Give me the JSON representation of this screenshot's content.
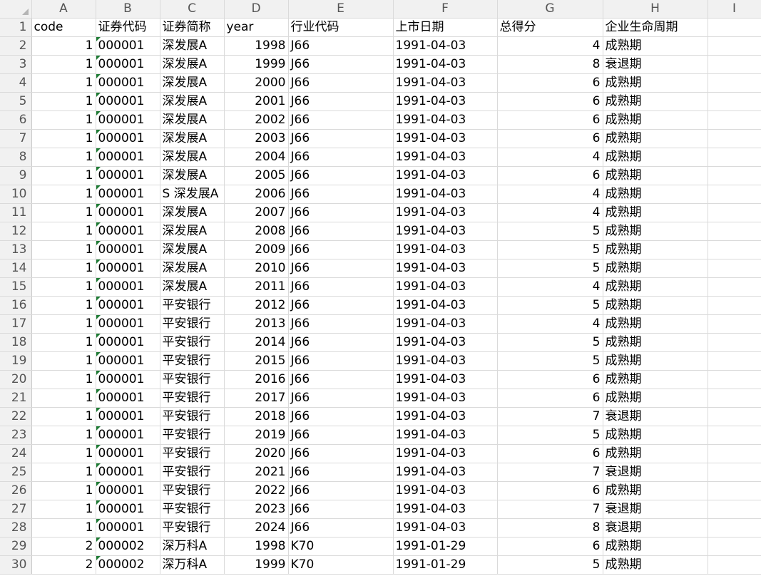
{
  "sheet": {
    "columns": [
      "A",
      "B",
      "C",
      "D",
      "E",
      "F",
      "G",
      "H",
      "I"
    ],
    "header_row": {
      "num": "1",
      "cells": [
        "code",
        "证券代码",
        "证券简称",
        "year",
        "行业代码",
        "上市日期",
        "总得分",
        "企业生命周期",
        ""
      ]
    },
    "rows": [
      {
        "num": "2",
        "cells": [
          "1",
          "000001",
          "深发展A",
          "1998",
          "J66",
          "1991-04-03",
          "4",
          "成熟期",
          ""
        ]
      },
      {
        "num": "3",
        "cells": [
          "1",
          "000001",
          "深发展A",
          "1999",
          "J66",
          "1991-04-03",
          "8",
          "衰退期",
          ""
        ]
      },
      {
        "num": "4",
        "cells": [
          "1",
          "000001",
          "深发展A",
          "2000",
          "J66",
          "1991-04-03",
          "6",
          "成熟期",
          ""
        ]
      },
      {
        "num": "5",
        "cells": [
          "1",
          "000001",
          "深发展A",
          "2001",
          "J66",
          "1991-04-03",
          "6",
          "成熟期",
          ""
        ]
      },
      {
        "num": "6",
        "cells": [
          "1",
          "000001",
          "深发展A",
          "2002",
          "J66",
          "1991-04-03",
          "6",
          "成熟期",
          ""
        ]
      },
      {
        "num": "7",
        "cells": [
          "1",
          "000001",
          "深发展A",
          "2003",
          "J66",
          "1991-04-03",
          "6",
          "成熟期",
          ""
        ]
      },
      {
        "num": "8",
        "cells": [
          "1",
          "000001",
          "深发展A",
          "2004",
          "J66",
          "1991-04-03",
          "4",
          "成熟期",
          ""
        ]
      },
      {
        "num": "9",
        "cells": [
          "1",
          "000001",
          "深发展A",
          "2005",
          "J66",
          "1991-04-03",
          "6",
          "成熟期",
          ""
        ]
      },
      {
        "num": "10",
        "cells": [
          "1",
          "000001",
          "S 深发展A",
          "2006",
          "J66",
          "1991-04-03",
          "4",
          "成熟期",
          ""
        ]
      },
      {
        "num": "11",
        "cells": [
          "1",
          "000001",
          "深发展A",
          "2007",
          "J66",
          "1991-04-03",
          "4",
          "成熟期",
          ""
        ]
      },
      {
        "num": "12",
        "cells": [
          "1",
          "000001",
          "深发展A",
          "2008",
          "J66",
          "1991-04-03",
          "5",
          "成熟期",
          ""
        ]
      },
      {
        "num": "13",
        "cells": [
          "1",
          "000001",
          "深发展A",
          "2009",
          "J66",
          "1991-04-03",
          "5",
          "成熟期",
          ""
        ]
      },
      {
        "num": "14",
        "cells": [
          "1",
          "000001",
          "深发展A",
          "2010",
          "J66",
          "1991-04-03",
          "5",
          "成熟期",
          ""
        ]
      },
      {
        "num": "15",
        "cells": [
          "1",
          "000001",
          "深发展A",
          "2011",
          "J66",
          "1991-04-03",
          "4",
          "成熟期",
          ""
        ]
      },
      {
        "num": "16",
        "cells": [
          "1",
          "000001",
          "平安银行",
          "2012",
          "J66",
          "1991-04-03",
          "5",
          "成熟期",
          ""
        ]
      },
      {
        "num": "17",
        "cells": [
          "1",
          "000001",
          "平安银行",
          "2013",
          "J66",
          "1991-04-03",
          "4",
          "成熟期",
          ""
        ]
      },
      {
        "num": "18",
        "cells": [
          "1",
          "000001",
          "平安银行",
          "2014",
          "J66",
          "1991-04-03",
          "5",
          "成熟期",
          ""
        ]
      },
      {
        "num": "19",
        "cells": [
          "1",
          "000001",
          "平安银行",
          "2015",
          "J66",
          "1991-04-03",
          "5",
          "成熟期",
          ""
        ]
      },
      {
        "num": "20",
        "cells": [
          "1",
          "000001",
          "平安银行",
          "2016",
          "J66",
          "1991-04-03",
          "6",
          "成熟期",
          ""
        ]
      },
      {
        "num": "21",
        "cells": [
          "1",
          "000001",
          "平安银行",
          "2017",
          "J66",
          "1991-04-03",
          "6",
          "成熟期",
          ""
        ]
      },
      {
        "num": "22",
        "cells": [
          "1",
          "000001",
          "平安银行",
          "2018",
          "J66",
          "1991-04-03",
          "7",
          "衰退期",
          ""
        ]
      },
      {
        "num": "23",
        "cells": [
          "1",
          "000001",
          "平安银行",
          "2019",
          "J66",
          "1991-04-03",
          "5",
          "成熟期",
          ""
        ]
      },
      {
        "num": "24",
        "cells": [
          "1",
          "000001",
          "平安银行",
          "2020",
          "J66",
          "1991-04-03",
          "6",
          "成熟期",
          ""
        ]
      },
      {
        "num": "25",
        "cells": [
          "1",
          "000001",
          "平安银行",
          "2021",
          "J66",
          "1991-04-03",
          "7",
          "衰退期",
          ""
        ]
      },
      {
        "num": "26",
        "cells": [
          "1",
          "000001",
          "平安银行",
          "2022",
          "J66",
          "1991-04-03",
          "6",
          "成熟期",
          ""
        ]
      },
      {
        "num": "27",
        "cells": [
          "1",
          "000001",
          "平安银行",
          "2023",
          "J66",
          "1991-04-03",
          "7",
          "衰退期",
          ""
        ]
      },
      {
        "num": "28",
        "cells": [
          "1",
          "000001",
          "平安银行",
          "2024",
          "J66",
          "1991-04-03",
          "8",
          "衰退期",
          ""
        ]
      },
      {
        "num": "29",
        "cells": [
          "2",
          "000002",
          "深万科A",
          "1998",
          "K70",
          "1991-01-29",
          "6",
          "成熟期",
          ""
        ]
      },
      {
        "num": "30",
        "cells": [
          "2",
          "000002",
          "深万科A",
          "1999",
          "K70",
          "1991-01-29",
          "5",
          "成熟期",
          ""
        ]
      }
    ]
  }
}
